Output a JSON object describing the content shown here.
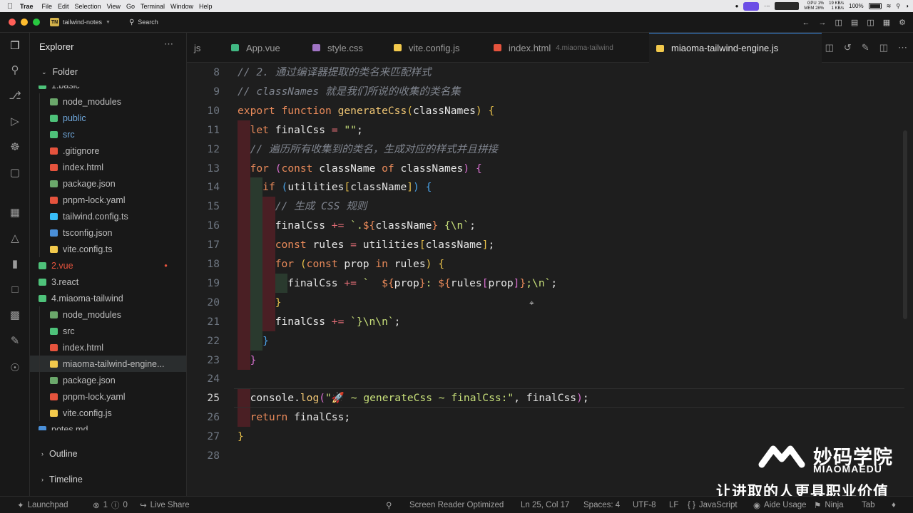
{
  "menubar": {
    "app": "Trae",
    "items": [
      "File",
      "Edit",
      "Selection",
      "View",
      "Go",
      "Terminal",
      "Window",
      "Help"
    ],
    "gpu_label": "GPU",
    "gpu_value": "1%",
    "mem_label": "MEM",
    "mem_value": "28%",
    "net_up": "19 KB/s",
    "net_down": "1 KB/s",
    "battery": "100%"
  },
  "titlebar": {
    "project_badge": "TN",
    "project": "tailwind-notes",
    "search": "Search"
  },
  "sidebar": {
    "title": "Explorer",
    "section_folder": "Folder",
    "section_outline": "Outline",
    "section_timeline": "Timeline",
    "tree": [
      {
        "label": "1.basic",
        "icon_color": "#4ec27a",
        "indent": 0,
        "color": "#bdbdbd"
      },
      {
        "label": "node_modules",
        "icon_color": "#6ba86b",
        "indent": 1,
        "color": "#bdbdbd"
      },
      {
        "label": "public",
        "icon_color": "#4ec27a",
        "indent": 1,
        "color": "#6fa8dc"
      },
      {
        "label": "src",
        "icon_color": "#4ec27a",
        "indent": 1,
        "color": "#6fa8dc"
      },
      {
        "label": ".gitignore",
        "icon_color": "#e5533d",
        "indent": 1,
        "color": "#bdbdbd"
      },
      {
        "label": "index.html",
        "icon_color": "#e5533d",
        "indent": 1,
        "color": "#bdbdbd"
      },
      {
        "label": "package.json",
        "icon_color": "#6ba86b",
        "indent": 1,
        "color": "#bdbdbd"
      },
      {
        "label": "pnpm-lock.yaml",
        "icon_color": "#e5533d",
        "indent": 1,
        "color": "#bdbdbd"
      },
      {
        "label": "tailwind.config.ts",
        "icon_color": "#38bdf8",
        "indent": 1,
        "color": "#bdbdbd"
      },
      {
        "label": "tsconfig.json",
        "icon_color": "#4a8fd8",
        "indent": 1,
        "color": "#bdbdbd"
      },
      {
        "label": "vite.config.ts",
        "icon_color": "#f2c94c",
        "indent": 1,
        "color": "#bdbdbd"
      },
      {
        "label": "2.vue",
        "icon_color": "#4ec27a",
        "indent": 0,
        "color": "#e5533d"
      },
      {
        "label": "3.react",
        "icon_color": "#4ec27a",
        "indent": 0,
        "color": "#bdbdbd"
      },
      {
        "label": "4.miaoma-tailwind",
        "icon_color": "#4ec27a",
        "indent": 0,
        "color": "#bdbdbd"
      },
      {
        "label": "node_modules",
        "icon_color": "#6ba86b",
        "indent": 1,
        "color": "#bdbdbd"
      },
      {
        "label": "src",
        "icon_color": "#4ec27a",
        "indent": 1,
        "color": "#bdbdbd"
      },
      {
        "label": "index.html",
        "icon_color": "#e5533d",
        "indent": 1,
        "color": "#bdbdbd"
      },
      {
        "label": "miaoma-tailwind-engine...",
        "icon_color": "#f2c94c",
        "indent": 1,
        "color": "#bdbdbd"
      },
      {
        "label": "package.json",
        "icon_color": "#6ba86b",
        "indent": 1,
        "color": "#bdbdbd"
      },
      {
        "label": "pnpm-lock.yaml",
        "icon_color": "#e5533d",
        "indent": 1,
        "color": "#bdbdbd"
      },
      {
        "label": "vite.config.js",
        "icon_color": "#f2c94c",
        "indent": 1,
        "color": "#bdbdbd"
      },
      {
        "label": "notes.md",
        "icon_color": "#4a8fd8",
        "indent": 0,
        "color": "#bdbdbd"
      }
    ]
  },
  "tabs": [
    {
      "label": "js",
      "hint": "",
      "icon_color": ""
    },
    {
      "label": "App.vue",
      "hint": "",
      "icon_color": "#41b883"
    },
    {
      "label": "style.css",
      "hint": "",
      "icon_color": "#a074c4"
    },
    {
      "label": "vite.config.js",
      "hint": "",
      "icon_color": "#f2c94c"
    },
    {
      "label": "index.html",
      "hint": "4.miaoma-tailwind",
      "icon_color": "#e5533d"
    },
    {
      "label": "miaoma-tailwind-engine.js",
      "hint": "",
      "icon_color": "#f2c94c"
    }
  ],
  "editor": {
    "current_line": 25,
    "lines": [
      {
        "n": 8,
        "tokens": [
          [
            "cm",
            "// 2. 通过编译器提取的类名来匹配样式"
          ]
        ]
      },
      {
        "n": 9,
        "tokens": [
          [
            "cm",
            "// classNames 就是我们所说的收集的类名集"
          ]
        ]
      },
      {
        "n": 10,
        "tokens": [
          [
            "kw",
            "export "
          ],
          [
            "kw",
            "function "
          ],
          [
            "fn",
            "generateCss"
          ],
          [
            "br1",
            "("
          ],
          [
            "vr",
            "classNames"
          ],
          [
            "br1",
            ")"
          ],
          [
            "vr",
            " "
          ],
          [
            "br1",
            "{"
          ]
        ]
      },
      {
        "n": 11,
        "tokens": [
          [
            "vr",
            "  "
          ],
          [
            "kw",
            "let "
          ],
          [
            "vr",
            "finalCss "
          ],
          [
            "op",
            "= "
          ],
          [
            "str",
            "\"\""
          ],
          [
            "vr",
            ";"
          ]
        ]
      },
      {
        "n": 12,
        "tokens": [
          [
            "vr",
            "  "
          ],
          [
            "cm",
            "// 遍历所有收集到的类名，生成对应的样式并且拼接"
          ]
        ]
      },
      {
        "n": 13,
        "tokens": [
          [
            "vr",
            "  "
          ],
          [
            "kw",
            "for "
          ],
          [
            "br2",
            "("
          ],
          [
            "kw",
            "const "
          ],
          [
            "vr",
            "className "
          ],
          [
            "kw",
            "of "
          ],
          [
            "vr",
            "classNames"
          ],
          [
            "br2",
            ")"
          ],
          [
            "vr",
            " "
          ],
          [
            "br2",
            "{"
          ]
        ]
      },
      {
        "n": 14,
        "tokens": [
          [
            "vr",
            "    "
          ],
          [
            "kw",
            "if "
          ],
          [
            "br3",
            "("
          ],
          [
            "vr",
            "utilities"
          ],
          [
            "br1",
            "["
          ],
          [
            "vr",
            "className"
          ],
          [
            "br1",
            "]"
          ],
          [
            "br3",
            ")"
          ],
          [
            "vr",
            " "
          ],
          [
            "br3",
            "{"
          ]
        ]
      },
      {
        "n": 15,
        "tokens": [
          [
            "vr",
            "      "
          ],
          [
            "cm",
            "// 生成 CSS 规则"
          ]
        ]
      },
      {
        "n": 16,
        "tokens": [
          [
            "vr",
            "      finalCss "
          ],
          [
            "op",
            "+= "
          ],
          [
            "str",
            "`."
          ],
          [
            "kw",
            "${"
          ],
          [
            "vr",
            "className"
          ],
          [
            "kw",
            "}"
          ],
          [
            "str",
            " {\\n`"
          ],
          [
            "vr",
            ";"
          ]
        ]
      },
      {
        "n": 17,
        "tokens": [
          [
            "vr",
            "      "
          ],
          [
            "kw",
            "const "
          ],
          [
            "vr",
            "rules "
          ],
          [
            "op",
            "= "
          ],
          [
            "vr",
            "utilities"
          ],
          [
            "br1",
            "["
          ],
          [
            "vr",
            "className"
          ],
          [
            "br1",
            "]"
          ],
          [
            "vr",
            ";"
          ]
        ]
      },
      {
        "n": 18,
        "tokens": [
          [
            "vr",
            "      "
          ],
          [
            "kw",
            "for "
          ],
          [
            "br1",
            "("
          ],
          [
            "kw",
            "const "
          ],
          [
            "vr",
            "prop "
          ],
          [
            "kw",
            "in "
          ],
          [
            "vr",
            "rules"
          ],
          [
            "br1",
            ")"
          ],
          [
            "vr",
            " "
          ],
          [
            "br1",
            "{"
          ]
        ]
      },
      {
        "n": 19,
        "tokens": [
          [
            "vr",
            "        finalCss "
          ],
          [
            "op",
            "+= "
          ],
          [
            "str",
            "`  "
          ],
          [
            "kw",
            "${"
          ],
          [
            "vr",
            "prop"
          ],
          [
            "kw",
            "}"
          ],
          [
            "str",
            ": "
          ],
          [
            "kw",
            "${"
          ],
          [
            "vr",
            "rules"
          ],
          [
            "br2",
            "["
          ],
          [
            "vr",
            "prop"
          ],
          [
            "br2",
            "]"
          ],
          [
            "kw",
            "}"
          ],
          [
            "str",
            ";\\n`"
          ],
          [
            "vr",
            ";"
          ]
        ]
      },
      {
        "n": 20,
        "tokens": [
          [
            "vr",
            "      "
          ],
          [
            "br1",
            "}"
          ]
        ]
      },
      {
        "n": 21,
        "tokens": [
          [
            "vr",
            "      finalCss "
          ],
          [
            "op",
            "+= "
          ],
          [
            "str",
            "`}\\n\\n`"
          ],
          [
            "vr",
            ";"
          ]
        ]
      },
      {
        "n": 22,
        "tokens": [
          [
            "vr",
            "    "
          ],
          [
            "br3",
            "}"
          ]
        ]
      },
      {
        "n": 23,
        "tokens": [
          [
            "vr",
            "  "
          ],
          [
            "br2",
            "}"
          ]
        ]
      },
      {
        "n": 24,
        "tokens": []
      },
      {
        "n": 25,
        "tokens": [
          [
            "vr",
            "  console."
          ],
          [
            "fn",
            "log"
          ],
          [
            "br2",
            "("
          ],
          [
            "str",
            "\"🚀 ~ generateCss ~ finalCss:\""
          ],
          [
            "vr",
            ", finalCss"
          ],
          [
            "br2",
            ")"
          ],
          [
            "vr",
            ";"
          ]
        ]
      },
      {
        "n": 26,
        "tokens": [
          [
            "vr",
            "  "
          ],
          [
            "kw",
            "return "
          ],
          [
            "vr",
            "finalCss;"
          ]
        ]
      },
      {
        "n": 27,
        "tokens": [
          [
            "br1",
            "}"
          ]
        ]
      },
      {
        "n": 28,
        "tokens": []
      }
    ]
  },
  "statusbar": {
    "launchpad": "Launchpad",
    "errors": "1",
    "warnings": "0",
    "live_share": "Live Share",
    "screen_reader": "Screen Reader Optimized",
    "position": "Ln 25, Col 17",
    "spaces": "Spaces: 4",
    "encoding": "UTF-8",
    "eol": "LF",
    "language": "JavaScript",
    "aide": "Aide Usage",
    "ninja": "Ninja",
    "tab": "Tab"
  },
  "watermark": {
    "cn": "妙码学院",
    "en": "MIAOMAEDU",
    "slogan": "让进取的人更具职业价值"
  },
  "colors": {
    "accent": "#3b8eea",
    "indent_red": "#4a1f24",
    "indent_green": "#2a3a2e"
  }
}
